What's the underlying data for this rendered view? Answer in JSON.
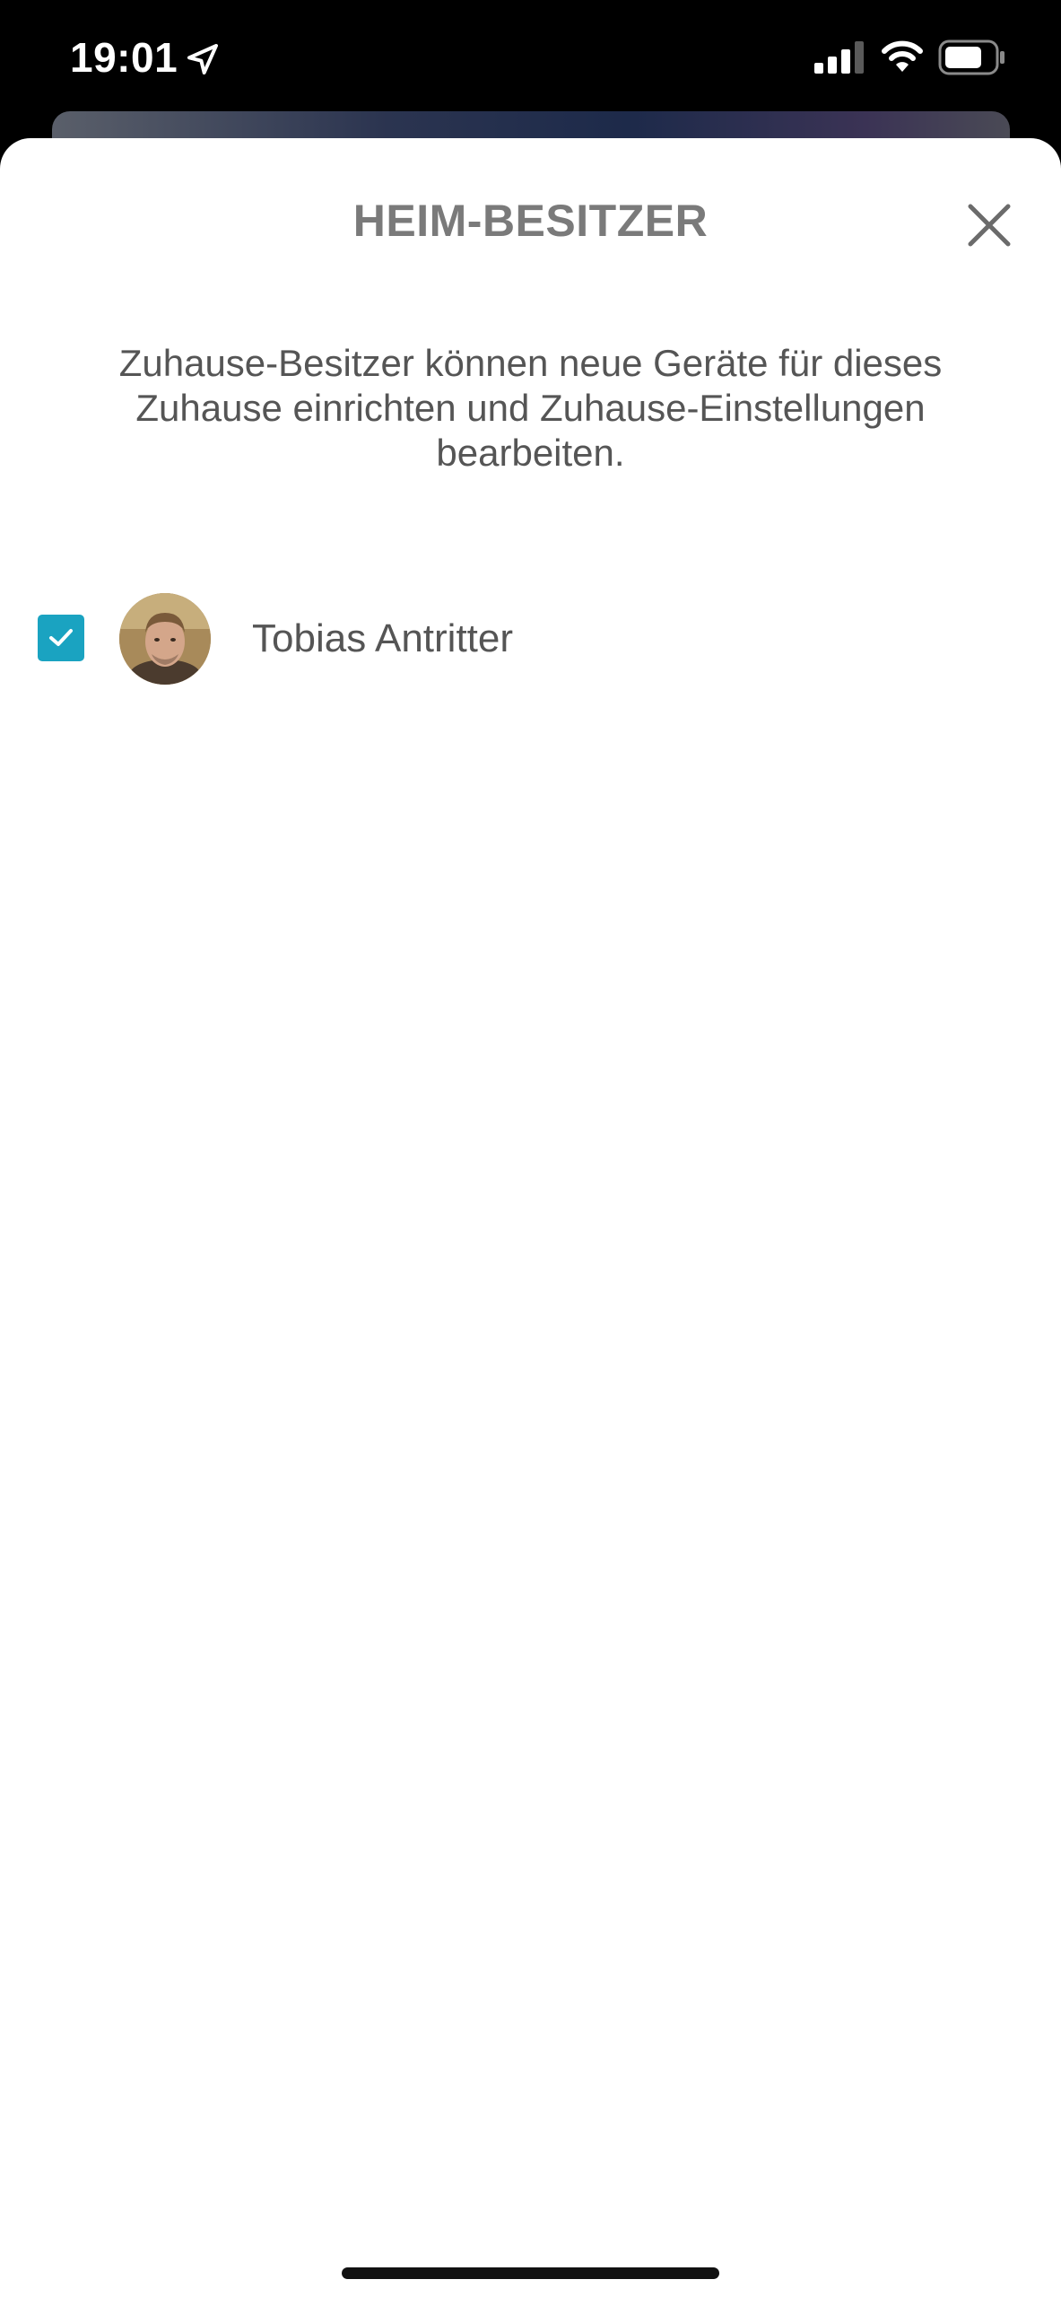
{
  "status_bar": {
    "time": "19:01",
    "icons": [
      "location-arrow-icon",
      "cellular-signal-icon",
      "wifi-icon",
      "battery-icon"
    ]
  },
  "sheet": {
    "title": "HEIM-BESITZER",
    "close_icon": "close-icon",
    "description": "Zuhause-Besitzer können neue Geräte für dieses Zuhause einrichten und Zuhause-Einstellungen bearbeiten.",
    "owners": [
      {
        "name": "Tobias Antritter",
        "checked": true
      }
    ]
  },
  "colors": {
    "accent": "#1aa3c1",
    "title_gray": "#7a7a7a",
    "text_gray": "#555555",
    "background": "#ffffff"
  }
}
